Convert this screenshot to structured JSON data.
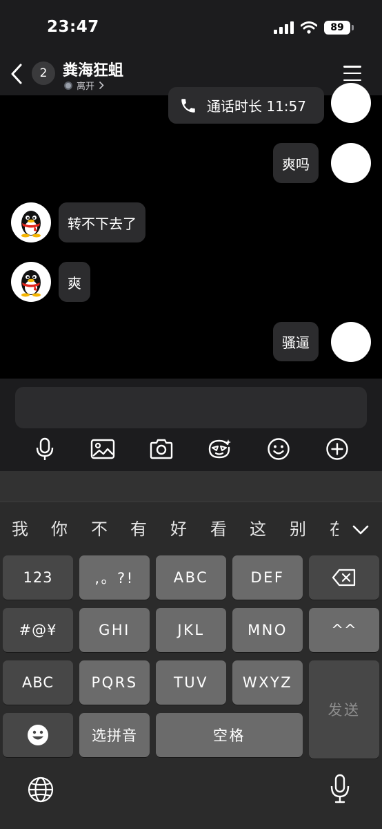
{
  "status_bar": {
    "time": "23:47",
    "battery": "89"
  },
  "header": {
    "unread_count": "2",
    "peer_name": "粪海狂蛆",
    "presence": "离开"
  },
  "messages": [
    {
      "side": "right",
      "kind": "call",
      "text": "通话时长 11:57"
    },
    {
      "side": "right",
      "kind": "text",
      "text": "爽吗"
    },
    {
      "side": "left",
      "kind": "text",
      "text": "转不下去了"
    },
    {
      "side": "left",
      "kind": "text",
      "text": "爽"
    },
    {
      "side": "right",
      "kind": "text",
      "text": "骚逼"
    }
  ],
  "composer": {
    "tools": [
      "microphone-icon",
      "image-icon",
      "camera-icon",
      "sticker-icon",
      "emoji-icon",
      "plus-icon"
    ]
  },
  "keyboard": {
    "candidates": [
      "我",
      "你",
      "不",
      "有",
      "好",
      "看",
      "这",
      "别",
      "在"
    ],
    "keys": {
      "num": "123",
      "punct": ",。?!",
      "abc": "ABC",
      "def": "DEF",
      "symbols": "#@¥",
      "ghi": "GHI",
      "jkl": "JKL",
      "mno": "MNO",
      "face": "^^",
      "eng": "ABC",
      "pqrs": "PQRS",
      "tuv": "TUV",
      "wxyz": "WXYZ",
      "pinyin": "选拼音",
      "space": "空格",
      "send": "发送"
    }
  },
  "colors": {
    "background": "#000000",
    "bar": "#1c1c1e",
    "bubble": "#2c2c2e",
    "key": "#6b6b6b",
    "key_dark": "#474747"
  }
}
